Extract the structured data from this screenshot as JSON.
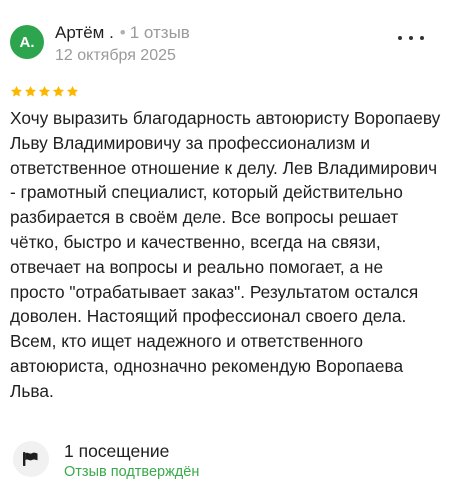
{
  "author": {
    "initials": "А.",
    "name": "Артём .",
    "separator": "•",
    "reviews_count": "1 отзыв",
    "avatar_color": "#2da44e"
  },
  "review": {
    "date": "12 октября 2025",
    "rating": 5,
    "star_color": "#fcb800",
    "text": "Хочу выразить благодарность автоюристу Воропаеву Льву Владимировичу за профессионализм и ответственное отношение к делу. Лев Владимирович - грамотный специалист, который действительно разбирается в своём деле. Все вопросы решает чётко, быстро и качественно, всегда на связи, отвечает на вопросы и реально помогает, а не просто \"отрабатывает заказ\". Результатом остался доволен. Настоящий профессионал своего дела. Всем, кто ищет надежного и ответственного автоюриста, однозначно рекомендую Воропаева Льва."
  },
  "menu": {
    "icon": "more-dots-icon"
  },
  "visit": {
    "icon": "flag-icon",
    "label": "1 посещение",
    "verified": "Отзыв подтверждён",
    "verified_color": "#3aa94b"
  }
}
